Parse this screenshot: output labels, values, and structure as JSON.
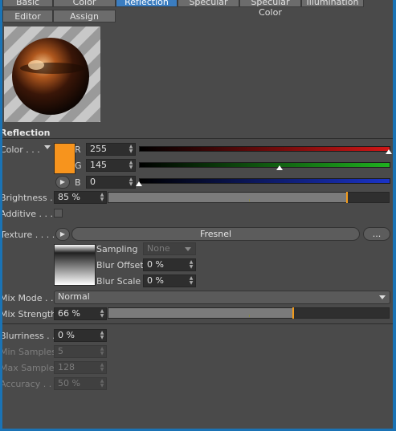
{
  "tabs_row1": [
    {
      "label": "Basic"
    },
    {
      "label": "Color"
    },
    {
      "label": "Reflection",
      "active": true
    },
    {
      "label": "Specular"
    },
    {
      "label": "Specular Color"
    },
    {
      "label": "Illumination"
    }
  ],
  "tabs_row2": [
    {
      "label": "Editor"
    },
    {
      "label": "Assign"
    }
  ],
  "section_title": "Reflection",
  "color": {
    "label": "Color . . .",
    "swatch": "#f7941d",
    "r": {
      "label": "R",
      "value": "255",
      "level": 1.0,
      "bar_color": "#d01616"
    },
    "g": {
      "label": "G",
      "value": "145",
      "level": 0.569,
      "bar_color": "#1fb01f"
    },
    "b": {
      "label": "B",
      "value": "0",
      "level": 0.0,
      "bar_color": "#1a33c8"
    }
  },
  "brightness": {
    "label": "Brightness . .",
    "value": "85 %",
    "level": 0.85
  },
  "additive": {
    "label": "Additive . . . ."
  },
  "texture": {
    "label": "Texture . . . .",
    "shader": "Fresnel",
    "more": "...",
    "sampling_label": "Sampling",
    "sampling_value": "None",
    "blur_offset_label": "Blur Offset",
    "blur_offset_value": "0 %",
    "blur_scale_label": "Blur Scale",
    "blur_scale_value": "0 %"
  },
  "mix_mode": {
    "label": "Mix Mode . . .",
    "value": "Normal"
  },
  "mix_strength": {
    "label": "Mix Strength",
    "value": "66 %",
    "level": 0.66
  },
  "blurriness": {
    "label": "Blurriness . . .",
    "value": "0 %"
  },
  "min_samples": {
    "label": "Min Samples",
    "value": "5"
  },
  "max_samples": {
    "label": "Max Samples",
    "value": "128"
  },
  "accuracy": {
    "label": "Accuracy . . .",
    "value": "50 %"
  },
  "colors": {
    "accent": "#f39b1a",
    "active_tab": "#3b7dc0",
    "panel": "#4a4a4a"
  }
}
